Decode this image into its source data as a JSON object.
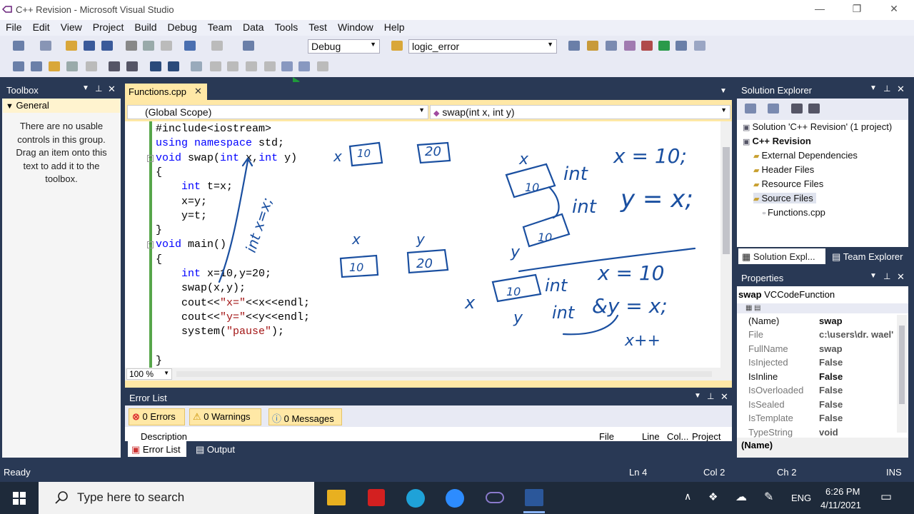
{
  "window": {
    "title": "C++ Revision - Microsoft Visual Studio",
    "minimize": "—",
    "restore": "❐",
    "close": "✕"
  },
  "menu": [
    "File",
    "Edit",
    "View",
    "Project",
    "Build",
    "Debug",
    "Team",
    "Data",
    "Tools",
    "Test",
    "Window",
    "Help"
  ],
  "toolbar": {
    "config": "Debug",
    "target": "logic_error"
  },
  "toolbox": {
    "title": "Toolbox",
    "group": "General",
    "empty_msg": "There are no usable controls in this group. Drag an item onto this text to add it to the toolbox."
  },
  "editor": {
    "tab": "Functions.cpp",
    "scope": "(Global Scope)",
    "member": "swap(int x, int y)",
    "zoom": "100 %",
    "lines": [
      {
        "parts": [
          {
            "t": "#include<iostream>",
            "c": ""
          }
        ]
      },
      {
        "parts": [
          {
            "t": "using ",
            "c": "kw"
          },
          {
            "t": "namespace ",
            "c": "kw"
          },
          {
            "t": "std;",
            "c": ""
          }
        ]
      },
      {
        "parts": [
          {
            "t": "void ",
            "c": "kw"
          },
          {
            "t": "swap(",
            "c": ""
          },
          {
            "t": "int ",
            "c": "kw"
          },
          {
            "t": "x,",
            "c": ""
          },
          {
            "t": "int ",
            "c": "kw"
          },
          {
            "t": "y)",
            "c": ""
          }
        ]
      },
      {
        "parts": [
          {
            "t": "{",
            "c": ""
          }
        ]
      },
      {
        "parts": [
          {
            "t": "    int ",
            "c": "kw"
          },
          {
            "t": "t=x;",
            "c": ""
          }
        ]
      },
      {
        "parts": [
          {
            "t": "    x=y;",
            "c": ""
          }
        ]
      },
      {
        "parts": [
          {
            "t": "    y=t;",
            "c": ""
          }
        ]
      },
      {
        "parts": [
          {
            "t": "}",
            "c": ""
          }
        ]
      },
      {
        "parts": [
          {
            "t": "void ",
            "c": "kw"
          },
          {
            "t": "main()",
            "c": ""
          }
        ]
      },
      {
        "parts": [
          {
            "t": "{",
            "c": ""
          }
        ]
      },
      {
        "parts": [
          {
            "t": "    int ",
            "c": "kw"
          },
          {
            "t": "x=10,y=20;",
            "c": ""
          }
        ]
      },
      {
        "parts": [
          {
            "t": "    swap(x,y);",
            "c": ""
          }
        ]
      },
      {
        "parts": [
          {
            "t": "    cout<<",
            "c": ""
          },
          {
            "t": "\"x=\"",
            "c": "str"
          },
          {
            "t": "<<x<<endl;",
            "c": ""
          }
        ]
      },
      {
        "parts": [
          {
            "t": "    cout<<",
            "c": ""
          },
          {
            "t": "\"y=\"",
            "c": "str"
          },
          {
            "t": "<<y<<endl;",
            "c": ""
          }
        ]
      },
      {
        "parts": [
          {
            "t": "    system(",
            "c": ""
          },
          {
            "t": "\"pause\"",
            "c": "str"
          },
          {
            "t": ");",
            "c": ""
          }
        ]
      },
      {
        "parts": [
          {
            "t": "",
            "c": ""
          }
        ]
      },
      {
        "parts": [
          {
            "t": "}",
            "c": ""
          }
        ]
      }
    ],
    "annotations": [
      "x",
      "10",
      "20",
      "int x=x;",
      "x",
      "y",
      "10",
      "20",
      "x",
      "int",
      "x = 10;",
      "10",
      "int",
      "y = x;",
      "y",
      "10",
      "x",
      "10",
      "int",
      "x = 10",
      "y",
      "int",
      "&y = x;",
      "x++"
    ]
  },
  "solution_explorer": {
    "title": "Solution Explorer",
    "nodes": [
      {
        "label": "Solution 'C++ Revision' (1 project)",
        "bold": false
      },
      {
        "label": "C++ Revision",
        "bold": true
      },
      {
        "label": "External Dependencies",
        "bold": false
      },
      {
        "label": "Header Files",
        "bold": false
      },
      {
        "label": "Resource Files",
        "bold": false
      },
      {
        "label": "Source Files",
        "bold": false
      },
      {
        "label": "Functions.cpp",
        "bold": false
      }
    ],
    "tab1": "Solution Expl...",
    "tab2": "Team Explorer"
  },
  "properties": {
    "title": "Properties",
    "object": "swap",
    "object_type": "VCCodeFunction",
    "rows": [
      {
        "name": "(Name)",
        "value": "swap"
      },
      {
        "name": "File",
        "value": "c:\\users\\dr. wael'"
      },
      {
        "name": "FullName",
        "value": "swap"
      },
      {
        "name": "IsInjected",
        "value": "False"
      },
      {
        "name": "IsInline",
        "value": "False"
      },
      {
        "name": "IsOverloaded",
        "value": "False"
      },
      {
        "name": "IsSealed",
        "value": "False"
      },
      {
        "name": "IsTemplate",
        "value": "False"
      },
      {
        "name": "TypeString",
        "value": "void"
      }
    ],
    "desc_title": "(Name)"
  },
  "error_list": {
    "title": "Error List",
    "errors": "0 Errors",
    "warnings": "0 Warnings",
    "messages": "0 Messages",
    "cols": [
      "Description",
      "File",
      "Line",
      "Col...",
      "Project"
    ],
    "tab1": "Error List",
    "tab2": "Output"
  },
  "status": {
    "ready": "Ready",
    "ln": "Ln 4",
    "col": "Col 2",
    "ch": "Ch 2",
    "ins": "INS"
  },
  "taskbar": {
    "search": "Type here to search",
    "lang": "ENG",
    "time": "6:26 PM",
    "date": "4/11/2021"
  },
  "colors": {
    "accent": "#293955",
    "tab_active": "#ffe8a6",
    "pen": "#1a4fa0"
  }
}
